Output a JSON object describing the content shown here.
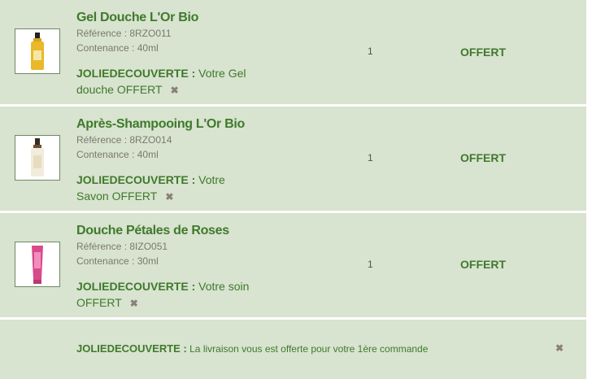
{
  "items": [
    {
      "name": "Gel Douche L'Or Bio",
      "reference": "Référence : 8RZO011",
      "contenance": "Contenance : 40ml",
      "promo_code": "JOLIEDECOUVERTE :",
      "promo_text": " Votre Gel douche OFFERT",
      "quantity": "1",
      "price": "OFFERT",
      "image": "bottle-amber"
    },
    {
      "name": "Après-Shampooing L'Or Bio",
      "reference": "Référence : 8RZO014",
      "contenance": "Contenance : 40ml",
      "promo_code": "JOLIEDECOUVERTE :",
      "promo_text": " Votre Savon OFFERT",
      "quantity": "1",
      "price": "OFFERT",
      "image": "bottle-brown"
    },
    {
      "name": "Douche Pétales de Roses",
      "reference": "Référence : 8IZO051",
      "contenance": "Contenance : 30ml",
      "promo_code": "JOLIEDECOUVERTE :",
      "promo_text": " Votre soin OFFERT",
      "quantity": "1",
      "price": "OFFERT",
      "image": "tube-pink"
    }
  ],
  "shipping": {
    "code": "JOLIEDECOUVERTE :",
    "text": " La livraison vous est offerte pour votre 1ère commande"
  },
  "remove_glyph": "✖",
  "colors": {
    "row_bg": "#d8e3d0",
    "accent_green": "#3f7a2b",
    "muted": "#7a7a6e",
    "remove": "#8a7f7a"
  }
}
